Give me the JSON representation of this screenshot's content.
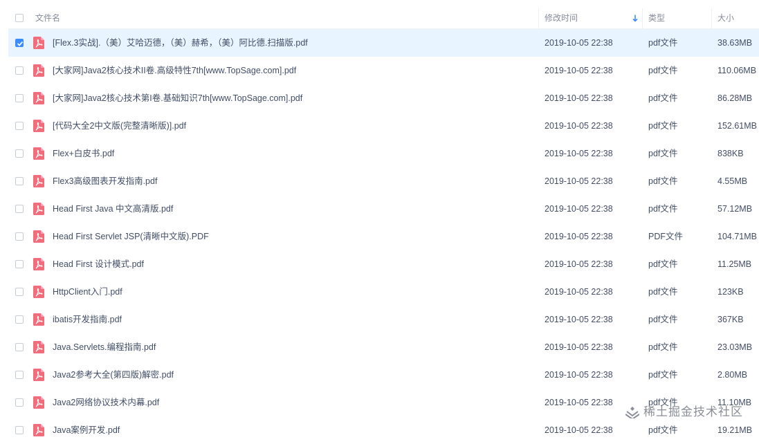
{
  "header": {
    "name": "文件名",
    "modified": "修改时间",
    "type": "类型",
    "size": "大小"
  },
  "colors": {
    "accent": "#3b8cff",
    "selected_row": "#e8f4ff",
    "pdf_icon": "#f36c7c"
  },
  "icons": {
    "row_icon": "pdf-file-icon",
    "sort": "sort-down-arrow-icon",
    "check": "checkmark-icon"
  },
  "files": [
    {
      "name": "[Flex.3实战].（美）艾哈迈德，（美）赫希，（美）阿比德.扫描版.pdf",
      "date": "2019-10-05 22:38",
      "type": "pdf文件",
      "size": "38.63MB",
      "checked": true
    },
    {
      "name": "[大家网]Java2核心技术II卷.高级特性7th[www.TopSage.com].pdf",
      "date": "2019-10-05 22:38",
      "type": "pdf文件",
      "size": "110.06MB",
      "checked": false
    },
    {
      "name": "[大家网]Java2核心技术第I卷.基础知识7th[www.TopSage.com].pdf",
      "date": "2019-10-05 22:38",
      "type": "pdf文件",
      "size": "86.28MB",
      "checked": false
    },
    {
      "name": "[代码大全2中文版(完整清晰版)].pdf",
      "date": "2019-10-05 22:38",
      "type": "pdf文件",
      "size": "152.61MB",
      "checked": false
    },
    {
      "name": "Flex+白皮书.pdf",
      "date": "2019-10-05 22:38",
      "type": "pdf文件",
      "size": "838KB",
      "checked": false
    },
    {
      "name": "Flex3高级图表开发指南.pdf",
      "date": "2019-10-05 22:38",
      "type": "pdf文件",
      "size": "4.55MB",
      "checked": false
    },
    {
      "name": "Head First Java 中文高清版.pdf",
      "date": "2019-10-05 22:38",
      "type": "pdf文件",
      "size": "57.12MB",
      "checked": false
    },
    {
      "name": "Head First Servlet JSP(清晰中文版).PDF",
      "date": "2019-10-05 22:38",
      "type": "PDF文件",
      "size": "104.71MB",
      "checked": false
    },
    {
      "name": "Head First 设计模式.pdf",
      "date": "2019-10-05 22:38",
      "type": "pdf文件",
      "size": "11.25MB",
      "checked": false
    },
    {
      "name": "HttpClient入门.pdf",
      "date": "2019-10-05 22:38",
      "type": "pdf文件",
      "size": "123KB",
      "checked": false
    },
    {
      "name": "ibatis开发指南.pdf",
      "date": "2019-10-05 22:38",
      "type": "pdf文件",
      "size": "367KB",
      "checked": false
    },
    {
      "name": "Java.Servlets.编程指南.pdf",
      "date": "2019-10-05 22:38",
      "type": "pdf文件",
      "size": "23.03MB",
      "checked": false
    },
    {
      "name": "Java2参考大全(第四版)解密.pdf",
      "date": "2019-10-05 22:38",
      "type": "pdf文件",
      "size": "2.80MB",
      "checked": false
    },
    {
      "name": "Java2网络协议技术内幕.pdf",
      "date": "2019-10-05 22:38",
      "type": "pdf文件",
      "size": "11.10MB",
      "checked": false
    },
    {
      "name": "Java案例开发.pdf",
      "date": "2019-10-05 22:38",
      "type": "pdf文件",
      "size": "19.21MB",
      "checked": false
    }
  ],
  "watermark": "稀土掘金技术社区"
}
